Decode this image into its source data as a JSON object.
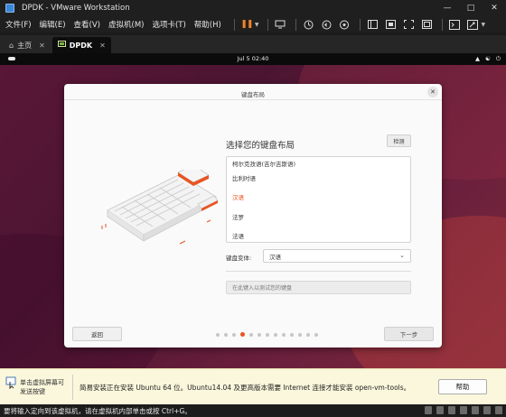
{
  "window": {
    "title": "DPDK - VMware Workstation"
  },
  "menu": [
    "文件(F)",
    "编辑(E)",
    "查看(V)",
    "虚拟机(M)",
    "选项卡(T)",
    "帮助(H)"
  ],
  "tabs": {
    "home": "主页",
    "vm": "DPDK"
  },
  "guest": {
    "clock": "Jul 5  02:40",
    "dialog": {
      "title": "键盘布局",
      "heading": "选择您的键盘布局",
      "detect_button": "检测",
      "layouts": [
        "柯尔克孜语(吉尔吉斯语)",
        "比利时语",
        "汉语",
        "法罗",
        "法语"
      ],
      "selected_layout": "汉语",
      "variant_label": "键盘变体:",
      "variant_value": "汉语",
      "test_placeholder": "在此键入以测试您的键盘",
      "back_button": "返回",
      "next_button": "下一步",
      "progress": {
        "total_steps": 13,
        "current_step": 4
      }
    }
  },
  "infobar": {
    "left_text": "单击虚拟屏幕可发送按键",
    "message": "简易安装正在安装 Ubuntu 64 位。Ubuntu14.04 及更高版本需要 Internet 连接才能安装 open-vm-tools。",
    "help_button": "帮助"
  },
  "statusbar": {
    "text": "要将输入定向到该虚拟机，请在虚拟机内部单击或按 Ctrl+G。"
  },
  "colors": {
    "accent": "#e95420",
    "toolbar_accent": "#f0832a"
  }
}
